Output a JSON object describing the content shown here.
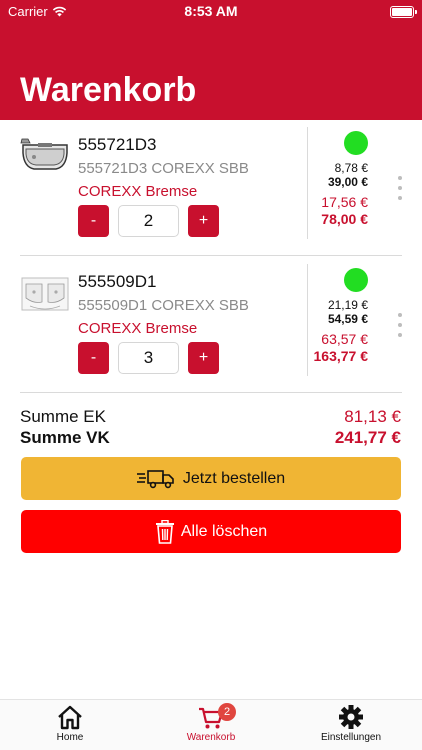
{
  "status_bar": {
    "carrier": "Carrier",
    "time": "8:53 AM"
  },
  "header": {
    "title": "Warenkorb"
  },
  "items": [
    {
      "number": "555721D3",
      "description": "555721D3 COREXX SBB",
      "brand": "COREXX Bremse",
      "quantity": "2",
      "minus_label": "-",
      "plus_label": "+",
      "availability_color": "#22dd22",
      "unit_ek": "8,78 €",
      "unit_vk": "39,00 €",
      "total_ek": "17,56 €",
      "total_vk": "78,00 €"
    },
    {
      "number": "555509D1",
      "description": "555509D1 COREXX SBB",
      "brand": "COREXX Bremse",
      "quantity": "3",
      "minus_label": "-",
      "plus_label": "+",
      "availability_color": "#22dd22",
      "unit_ek": "21,19 €",
      "unit_vk": "54,59 €",
      "total_ek": "63,57 €",
      "total_vk": "163,77 €"
    }
  ],
  "summary": {
    "ek_label": "Summe EK",
    "ek_value": "81,13 €",
    "vk_label": "Summe VK",
    "vk_value": "241,77 €"
  },
  "actions": {
    "order_label": "Jetzt bestellen",
    "order_icon": "delivery-truck-icon",
    "delete_label": "Alle löschen",
    "delete_icon": "trash-icon"
  },
  "tabbar": {
    "home_label": "Home",
    "cart_label": "Warenkorb",
    "cart_badge": "2",
    "settings_label": "Einstellungen"
  },
  "colors": {
    "brand_red": "#c8102e",
    "order_yellow": "#f0b534",
    "delete_red": "#ff0000",
    "available_green": "#22dd22"
  }
}
